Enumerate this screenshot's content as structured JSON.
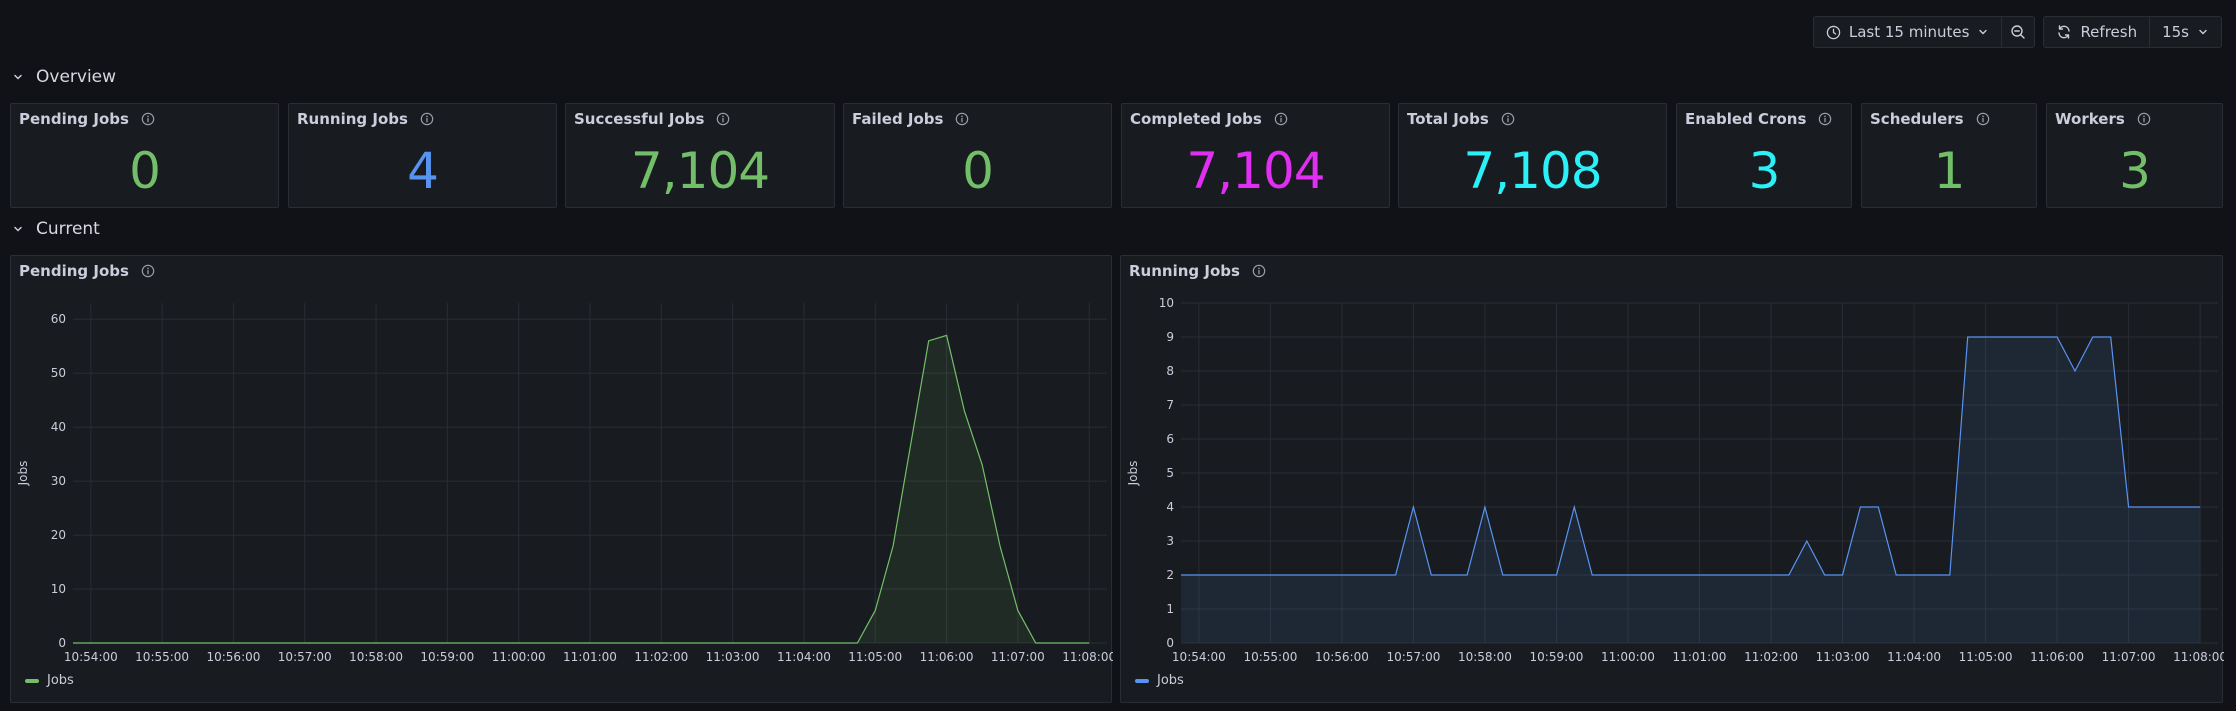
{
  "toolbar": {
    "time_range": "Last 15 minutes",
    "refresh_label": "Refresh",
    "refresh_interval": "15s"
  },
  "rows": {
    "overview": "Overview",
    "current": "Current"
  },
  "stats": [
    {
      "title": "Pending Jobs",
      "value": "0",
      "color": "#73bf69"
    },
    {
      "title": "Running Jobs",
      "value": "4",
      "color": "#5794f2"
    },
    {
      "title": "Successful Jobs",
      "value": "7,104",
      "color": "#73bf69"
    },
    {
      "title": "Failed Jobs",
      "value": "0",
      "color": "#73bf69"
    },
    {
      "title": "Completed Jobs",
      "value": "7,104",
      "color": "#e02ff2"
    },
    {
      "title": "Total Jobs",
      "value": "7,108",
      "color": "#2bf0f8"
    },
    {
      "title": "Enabled Crons",
      "value": "3",
      "color": "#2bf0f8"
    },
    {
      "title": "Schedulers",
      "value": "1",
      "color": "#73bf69"
    },
    {
      "title": "Workers",
      "value": "3",
      "color": "#73bf69"
    }
  ],
  "charts": {
    "pending": {
      "title": "Pending Jobs",
      "legend": "Jobs",
      "color": "#73bf69"
    },
    "running": {
      "title": "Running Jobs",
      "legend": "Jobs",
      "color": "#5794f2"
    }
  },
  "chart_data": [
    {
      "type": "area",
      "title": "Pending Jobs",
      "xlabel": "",
      "ylabel": "Jobs",
      "xlim": [
        "10:53:45",
        "11:08:15"
      ],
      "ylim": [
        0,
        63
      ],
      "y_ticks": [
        0,
        10,
        20,
        30,
        40,
        50,
        60
      ],
      "x_ticks": [
        "10:54:00",
        "10:55:00",
        "10:56:00",
        "10:57:00",
        "10:58:00",
        "10:59:00",
        "11:00:00",
        "11:01:00",
        "11:02:00",
        "11:03:00",
        "11:04:00",
        "11:05:00",
        "11:06:00",
        "11:07:00",
        "11:08:00"
      ],
      "grid": true,
      "legend": "bottom-left",
      "series": [
        {
          "name": "Jobs",
          "color": "#73bf69",
          "x": [
            "10:53:45",
            "11:04:45",
            "11:05:00",
            "11:05:15",
            "11:05:30",
            "11:05:45",
            "11:06:00",
            "11:06:15",
            "11:06:30",
            "11:06:45",
            "11:07:00",
            "11:07:15",
            "11:08:00"
          ],
          "y": [
            0,
            0,
            6,
            18,
            37,
            56,
            57,
            43,
            33,
            18,
            6,
            0,
            0
          ]
        }
      ]
    },
    {
      "type": "area",
      "title": "Running Jobs",
      "xlabel": "",
      "ylabel": "Jobs",
      "xlim": [
        "10:53:45",
        "11:08:15"
      ],
      "ylim": [
        0,
        10
      ],
      "y_ticks": [
        0,
        1,
        2,
        3,
        4,
        5,
        6,
        7,
        8,
        9,
        10
      ],
      "x_ticks": [
        "10:54:00",
        "10:55:00",
        "10:56:00",
        "10:57:00",
        "10:58:00",
        "10:59:00",
        "11:00:00",
        "11:01:00",
        "11:02:00",
        "11:03:00",
        "11:04:00",
        "11:05:00",
        "11:06:00",
        "11:07:00",
        "11:08:00"
      ],
      "grid": true,
      "legend": "bottom-left",
      "series": [
        {
          "name": "Jobs",
          "color": "#5794f2",
          "x": [
            "10:53:45",
            "10:56:45",
            "10:57:00",
            "10:57:15",
            "10:57:45",
            "10:58:00",
            "10:58:15",
            "10:59:00",
            "10:59:15",
            "10:59:30",
            "11:02:15",
            "11:02:30",
            "11:02:45",
            "11:03:00",
            "11:03:15",
            "11:03:30",
            "11:03:45",
            "11:04:30",
            "11:04:45",
            "11:05:45",
            "11:06:00",
            "11:06:15",
            "11:06:30",
            "11:06:45",
            "11:07:00",
            "11:08:00"
          ],
          "y": [
            2,
            2,
            4,
            2,
            2,
            4,
            2,
            2,
            4,
            2,
            2,
            3,
            2,
            2,
            4,
            4,
            2,
            2,
            9,
            9,
            9,
            8,
            9,
            9,
            4,
            4
          ]
        }
      ]
    }
  ]
}
